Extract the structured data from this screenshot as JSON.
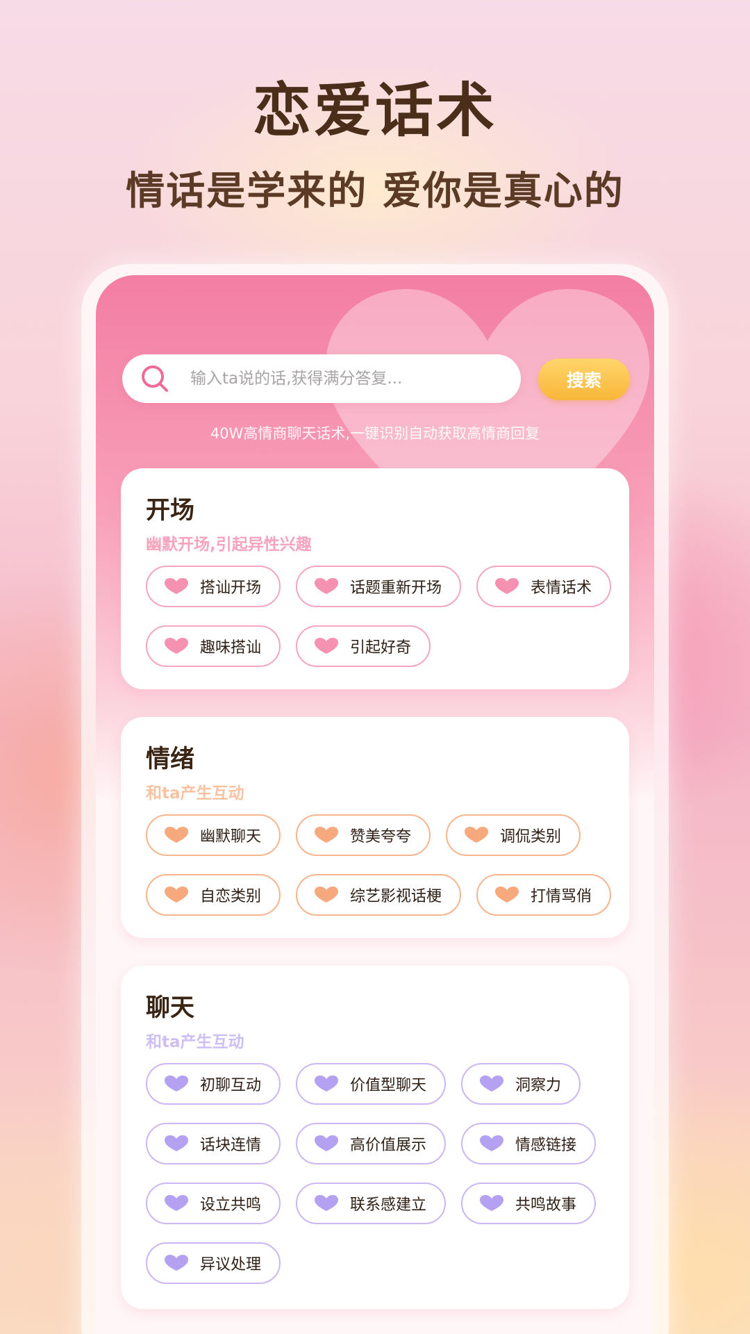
{
  "header": {
    "title": "恋爱话术",
    "subtitle": "情话是学来的 爱你是真心的"
  },
  "search": {
    "placeholder": "输入ta说的话,获得满分答复...",
    "button_label": "搜索",
    "tagline": "40W高情商聊天话术,一键识别自动获取高情商回复"
  },
  "colors": {
    "pink": "#f37ea3",
    "orange": "#f59a66",
    "purple": "#a891ee",
    "button": "#f8b73a"
  },
  "sections": [
    {
      "title": "开场",
      "subtitle": "幽默开场,引起异性兴趣",
      "theme": "pink",
      "rows": [
        [
          "搭讪开场",
          "话题重新开场",
          "表情话术"
        ],
        [
          "趣味搭讪",
          "引起好奇"
        ]
      ]
    },
    {
      "title": "情绪",
      "subtitle": "和ta产生互动",
      "theme": "orange",
      "rows": [
        [
          "幽默聊天",
          "赞美夸夸",
          "调侃类别"
        ],
        [
          "自恋类别",
          "综艺影视话梗",
          "打情骂俏"
        ]
      ]
    },
    {
      "title": "聊天",
      "subtitle": "和ta产生互动",
      "theme": "purple",
      "rows": [
        [
          "初聊互动",
          "价值型聊天",
          "洞察力"
        ],
        [
          "话块连情",
          "高价值展示",
          "情感链接"
        ],
        [
          "设立共鸣",
          "联系感建立",
          "共鸣故事"
        ],
        [
          "异议处理"
        ]
      ]
    }
  ]
}
